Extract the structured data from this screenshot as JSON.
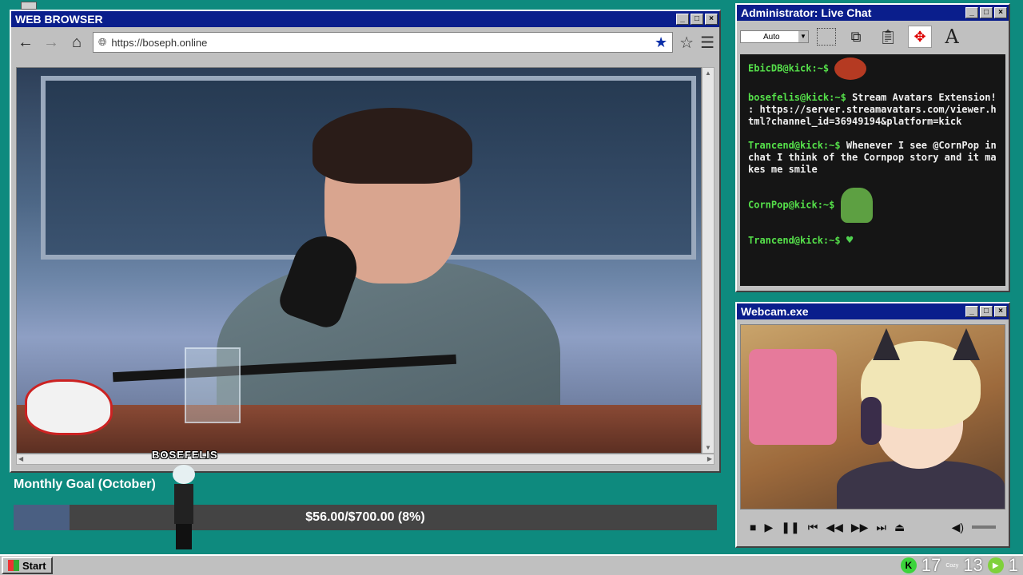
{
  "browser": {
    "title": "WEB BROWSER",
    "url": "https://boseph.online"
  },
  "chat": {
    "title": "Administrator: Live Chat",
    "zoom": "Auto",
    "messages": [
      {
        "user": "EbicDB@kick:~$",
        "text": ""
      },
      {
        "user": "bosefelis@kick:~$",
        "text": "Stream Avatars Extension! : https://server.streamavatars.com/viewer.html?channel_id=36949194&platform=kick"
      },
      {
        "user": "Trancend@kick:~$",
        "text": "Whenever I see @CornPop in chat I think of the Cornpop story and it makes me smile"
      },
      {
        "user": "CornPop@kick:~$",
        "text": ""
      },
      {
        "user": "Trancend@kick:~$",
        "text": ""
      }
    ]
  },
  "webcam": {
    "title": "Webcam.exe"
  },
  "goal": {
    "label": "Monthly Goal (October)",
    "text": "$56.00/$700.00 (8%)",
    "progress": 0.08
  },
  "avatar": {
    "name": "BOSEFELIS"
  },
  "taskbar": {
    "start": "Start",
    "count_kick": "17",
    "cozy": "Cozy",
    "count_cozy": "13",
    "count_play": "1"
  },
  "colors": {
    "desktop": "#0e8a7e",
    "titlebar": "#0a1e8c",
    "chat_user": "#55e04a",
    "goal_fill": "#4a5f82"
  }
}
